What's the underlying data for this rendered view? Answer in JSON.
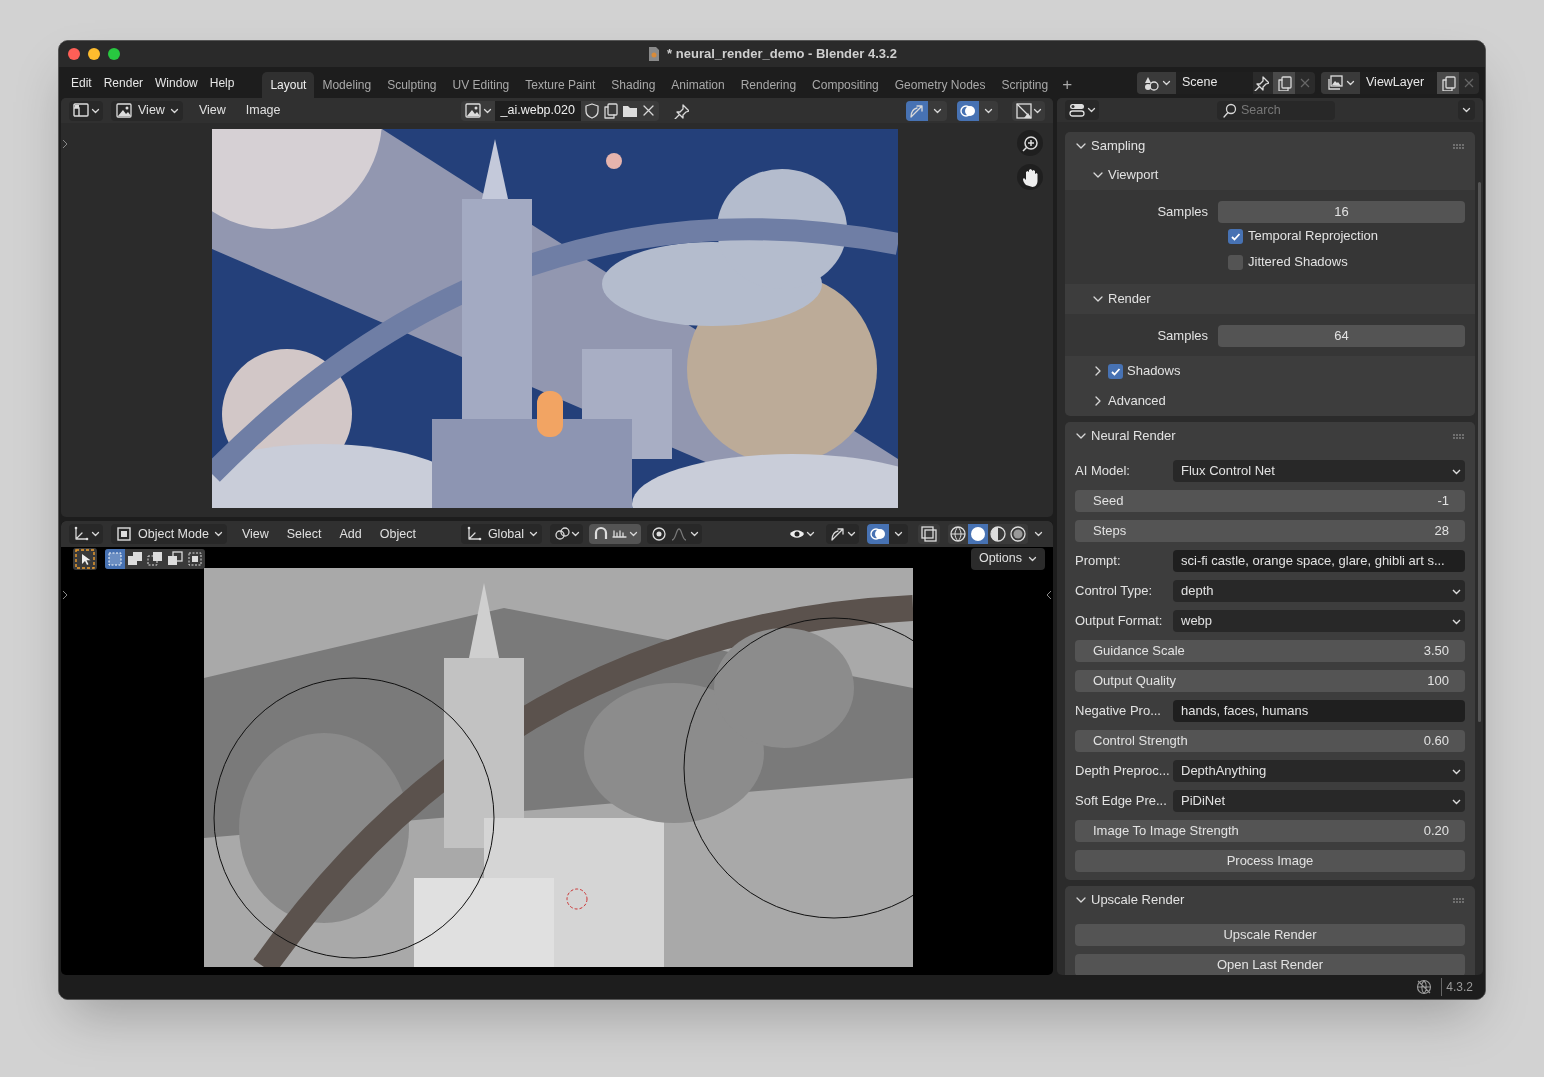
{
  "window": {
    "title": "* neural_render_demo - Blender 4.3.2"
  },
  "menu": [
    "Edit",
    "Render",
    "Window",
    "Help"
  ],
  "workspaces": [
    {
      "label": "Layout",
      "selected": true
    },
    {
      "label": "Modeling",
      "selected": false
    },
    {
      "label": "Sculpting",
      "selected": false
    },
    {
      "label": "UV Editing",
      "selected": false
    },
    {
      "label": "Texture Paint",
      "selected": false
    },
    {
      "label": "Shading",
      "selected": false
    },
    {
      "label": "Animation",
      "selected": false
    },
    {
      "label": "Rendering",
      "selected": false
    },
    {
      "label": "Compositing",
      "selected": false
    },
    {
      "label": "Geometry Nodes",
      "selected": false
    },
    {
      "label": "Scripting",
      "selected": false
    }
  ],
  "add_workspace": "+",
  "scene": "Scene",
  "view_layer": "ViewLayer",
  "image_editor": {
    "view_menu": "View",
    "menus": [
      "View",
      "Image"
    ],
    "image_name": "_ai.webp.020",
    "gizmos_on": true,
    "overlays_on": true
  },
  "viewport": {
    "mode": "Object Mode",
    "menus": [
      "View",
      "Select",
      "Add",
      "Object"
    ],
    "orientation": "Global",
    "options": "Options",
    "overlays_on": true,
    "shading": [
      {
        "selected": false
      },
      {
        "selected": true
      },
      {
        "selected": false
      },
      {
        "selected": false
      }
    ]
  },
  "properties": {
    "search": {
      "placeholder": "Search"
    },
    "panels": [
      {
        "title": "Sampling",
        "expanded": true,
        "subpanels": [
          {
            "title": "Viewport",
            "kind": "plain",
            "expanded": true,
            "rows": [
              {
                "kind": "number",
                "label": "Samples",
                "value": "16"
              },
              {
                "kind": "checkbox",
                "label": "Temporal Reprojection",
                "checked": true
              },
              {
                "kind": "checkbox",
                "label": "Jittered Shadows",
                "checked": false
              }
            ]
          },
          {
            "title": "Render",
            "kind": "plain",
            "expanded": true,
            "rows": [
              {
                "kind": "number",
                "label": "Samples",
                "value": "64"
              }
            ]
          },
          {
            "title": "Shadows",
            "kind": "toggle",
            "checked": true,
            "expanded": false
          },
          {
            "title": "Advanced",
            "kind": "plain",
            "expanded": false
          }
        ]
      },
      {
        "title": "Neural Render",
        "expanded": true,
        "rows": [
          {
            "kind": "dropdown",
            "label": "AI Model:",
            "value": "Flux Control Net"
          },
          {
            "kind": "slider",
            "label": "Seed",
            "value": "-1"
          },
          {
            "kind": "slider",
            "label": "Steps",
            "value": "28"
          },
          {
            "kind": "text",
            "label": "Prompt:",
            "value": "sci-fi castle, orange space, glare, ghibli art s..."
          },
          {
            "kind": "dropdown",
            "label": "Control Type:",
            "value": "depth"
          },
          {
            "kind": "dropdown",
            "label": "Output Format:",
            "value": "webp"
          },
          {
            "kind": "slider",
            "label": "Guidance Scale",
            "value": "3.50"
          },
          {
            "kind": "slider",
            "label": "Output Quality",
            "value": "100"
          },
          {
            "kind": "text",
            "label": "Negative Pro...",
            "value": "hands, faces, humans"
          },
          {
            "kind": "slider",
            "label": "Control Strength",
            "value": "0.60"
          },
          {
            "kind": "dropdown",
            "label": "Depth Preproc...",
            "value": "DepthAnything"
          },
          {
            "kind": "dropdown",
            "label": "Soft Edge Pre...",
            "value": "PiDiNet"
          },
          {
            "kind": "slider",
            "label": "Image To Image Strength",
            "value": "0.20"
          },
          {
            "kind": "button",
            "label": "Process Image"
          }
        ]
      },
      {
        "title": "Upscale Render",
        "expanded": true,
        "rows": [
          {
            "kind": "button",
            "label": "Upscale Render"
          },
          {
            "kind": "button",
            "label": "Open Last Render"
          }
        ]
      }
    ]
  },
  "status_bar": {
    "version": "4.3.2"
  }
}
